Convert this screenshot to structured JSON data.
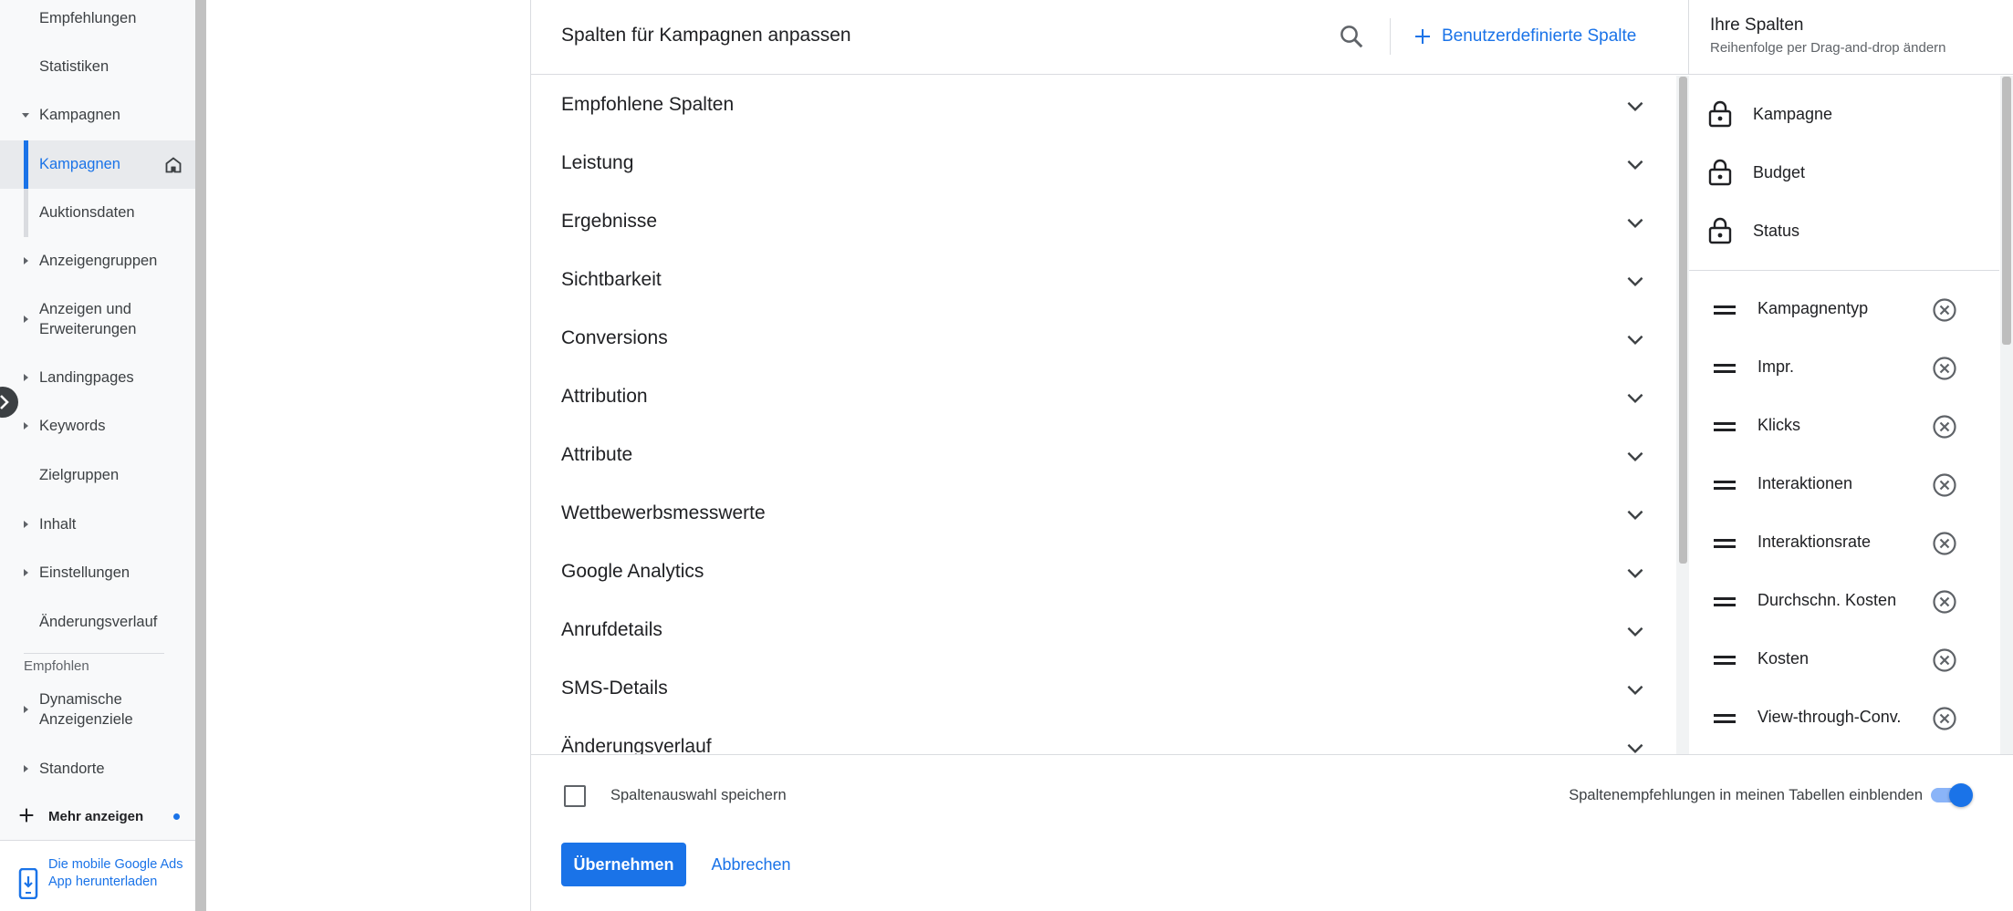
{
  "nav": {
    "items": [
      {
        "label": "Empfehlungen",
        "caret": "none",
        "state": "normal"
      },
      {
        "label": "Statistiken",
        "caret": "none",
        "state": "normal"
      },
      {
        "label": "Kampagnen",
        "caret": "down",
        "state": "normal"
      },
      {
        "label": "Kampagnen",
        "caret": "none",
        "state": "selected"
      },
      {
        "label": "Auktionsdaten",
        "caret": "none",
        "state": "sub"
      },
      {
        "label": "Anzeigengruppen",
        "caret": "right",
        "state": "normal"
      },
      {
        "label": "Anzeigen und Erweiterungen",
        "caret": "right",
        "state": "normal"
      },
      {
        "label": "Landingpages",
        "caret": "right",
        "state": "normal"
      },
      {
        "label": "Keywords",
        "caret": "right",
        "state": "normal"
      },
      {
        "label": "Zielgruppen",
        "caret": "none",
        "state": "normal"
      },
      {
        "label": "Inhalt",
        "caret": "right",
        "state": "normal"
      },
      {
        "label": "Einstellungen",
        "caret": "right",
        "state": "normal"
      },
      {
        "label": "Änderungsverlauf",
        "caret": "none",
        "state": "normal"
      },
      {
        "label": "Dynamische Anzeigenziele",
        "caret": "right",
        "state": "normal"
      },
      {
        "label": "Standorte",
        "caret": "right",
        "state": "normal"
      }
    ],
    "section_label": "Empfohlen",
    "more_label": "Mehr anzeigen",
    "app_promo": "Die mobile Google Ads App herunterladen"
  },
  "panel": {
    "title": "Spalten für Kampagnen anpassen",
    "custom_column_label": "Benutzerdefinierte Spalte",
    "categories": [
      "Empfohlene Spalten",
      "Leistung",
      "Ergebnisse",
      "Sichtbarkeit",
      "Conversions",
      "Attribution",
      "Attribute",
      "Wettbewerbsmesswerte",
      "Google Analytics",
      "Anrufdetails",
      "SMS-Details",
      "Änderungsverlauf"
    ]
  },
  "your_columns": {
    "title": "Ihre Spalten",
    "subtitle": "Reihenfolge per Drag-and-drop ändern",
    "locked": [
      "Kampagne",
      "Budget",
      "Status"
    ],
    "selected": [
      "Kampagnentyp",
      "Impr.",
      "Klicks",
      "Interaktionen",
      "Interaktionsrate",
      "Durchschn. Kosten",
      "Kosten",
      "View-through-Conv."
    ]
  },
  "footer": {
    "save_label": "Spaltenauswahl speichern",
    "recommend_label": "Spaltenempfehlungen in meinen Tabellen einblenden",
    "apply_label": "Übernehmen",
    "cancel_label": "Abbrechen"
  },
  "colors": {
    "accent": "#1a73e8",
    "text": "#202124",
    "secondary_text": "#5f6368",
    "divider": "#dadce0"
  }
}
